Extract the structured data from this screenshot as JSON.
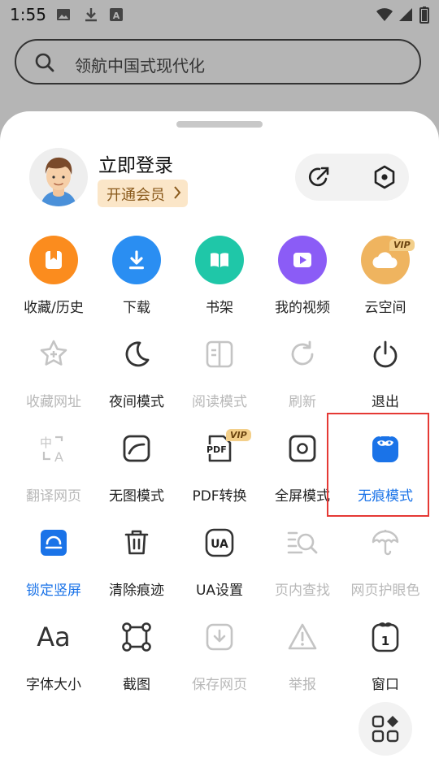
{
  "status_bar": {
    "time": "1:55",
    "icons": [
      "image-icon",
      "download-icon",
      "text-a-icon",
      "wifi-icon",
      "signal-icon",
      "battery-icon"
    ]
  },
  "search": {
    "text": "领航中国式现代化"
  },
  "profile": {
    "login_label": "立即登录",
    "vip_label": "开通会员",
    "actions": [
      "share-icon",
      "settings-icon"
    ]
  },
  "colors": {
    "accent": "#1a73e8",
    "disabled": "#b8b8b8",
    "vip_bg": "#fbe6c8",
    "highlight": "#e53935"
  },
  "row1": [
    {
      "label": "收藏/历史",
      "icon": "bookmark-icon",
      "color": "#fb8c1e"
    },
    {
      "label": "下载",
      "icon": "download-icon",
      "color": "#2a8ef2"
    },
    {
      "label": "书架",
      "icon": "book-icon",
      "color": "#1fc7a8"
    },
    {
      "label": "我的视频",
      "icon": "video-icon",
      "color": "#8b5cf6"
    },
    {
      "label": "云空间",
      "icon": "cloud-icon",
      "color": "#efb45f",
      "badge": "VIP"
    }
  ],
  "row2": [
    {
      "label": "收藏网址",
      "icon": "star-add-icon",
      "disabled": true
    },
    {
      "label": "夜间模式",
      "icon": "moon-icon"
    },
    {
      "label": "阅读模式",
      "icon": "reader-icon",
      "disabled": true
    },
    {
      "label": "刷新",
      "icon": "refresh-icon",
      "disabled": true
    },
    {
      "label": "退出",
      "icon": "power-icon"
    }
  ],
  "row3": [
    {
      "label": "翻译网页",
      "icon": "translate-icon",
      "disabled": true
    },
    {
      "label": "无图模式",
      "icon": "no-image-icon"
    },
    {
      "label": "PDF转换",
      "icon": "pdf-icon",
      "badge": "VIP"
    },
    {
      "label": "全屏模式",
      "icon": "fullscreen-icon"
    },
    {
      "label": "无痕模式",
      "icon": "incognito-icon",
      "active": true
    }
  ],
  "row4": [
    {
      "label": "锁定竖屏",
      "icon": "lock-orientation-icon",
      "active": true
    },
    {
      "label": "清除痕迹",
      "icon": "trash-icon"
    },
    {
      "label": "UA设置",
      "icon": "ua-icon",
      "text": "UA"
    },
    {
      "label": "页内查找",
      "icon": "find-in-page-icon",
      "disabled": true
    },
    {
      "label": "网页护眼色",
      "icon": "umbrella-icon",
      "disabled": true
    }
  ],
  "row5": [
    {
      "label": "字体大小",
      "icon": "font-size-icon",
      "text": "Aa"
    },
    {
      "label": "截图",
      "icon": "screenshot-icon"
    },
    {
      "label": "保存网页",
      "icon": "save-page-icon",
      "disabled": true
    },
    {
      "label": "举报",
      "icon": "report-icon",
      "disabled": true
    },
    {
      "label": "窗口",
      "icon": "window-icon",
      "text": "1"
    }
  ],
  "fab": {
    "icon": "customize-grid-icon"
  }
}
